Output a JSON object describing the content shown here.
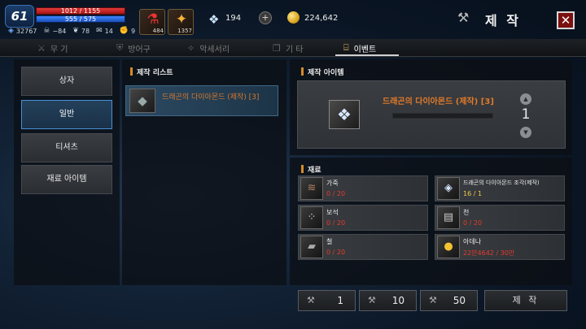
{
  "hud": {
    "level": "61",
    "hp": "1012 / 1155",
    "mp": "555 / 575",
    "stats": [
      {
        "icon": "crystal-small-icon",
        "glyph": "◈",
        "value": "32767"
      },
      {
        "icon": "skull-icon",
        "glyph": "☠",
        "value": "−84"
      },
      {
        "icon": "wing-icon",
        "glyph": "❦",
        "value": "78"
      },
      {
        "icon": "bag-icon",
        "glyph": "✉",
        "value": "14"
      },
      {
        "icon": "fist-icon",
        "glyph": "✊",
        "value": "9"
      }
    ],
    "potion_slot": {
      "icon": "red-potion-icon",
      "glyph": "⚗",
      "count": "484"
    },
    "scroll_slot": {
      "icon": "flame-scroll-icon",
      "glyph": "✦",
      "count": "1357"
    },
    "crystal_currency": "194",
    "gold": "224,642"
  },
  "window": {
    "title": "제 작"
  },
  "tabs": [
    {
      "label": "무 기",
      "icon": "swords-icon",
      "glyph": "⚔"
    },
    {
      "label": "방어구",
      "icon": "shield-icon",
      "glyph": "⛨"
    },
    {
      "label": "악세서리",
      "icon": "ring-icon",
      "glyph": "✧"
    },
    {
      "label": "기 타",
      "icon": "box-icon",
      "glyph": "❒"
    },
    {
      "label": "이벤트",
      "icon": "gift-icon",
      "glyph": "🎁"
    }
  ],
  "active_tab": "이벤트",
  "categories": [
    {
      "label": "상자",
      "active": false
    },
    {
      "label": "일반",
      "active": true
    },
    {
      "label": "티셔츠",
      "active": false
    },
    {
      "label": "재료 아이템",
      "active": false
    }
  ],
  "craft_list": {
    "header": "제작 리스트",
    "items": [
      {
        "name": "드래곤의 다이아몬드 (제작) [3]",
        "icon": "diamond-rough-icon",
        "glyph": "◆"
      }
    ]
  },
  "craft_item": {
    "header": "제작 아이템",
    "name": "드래곤의 다이아몬드 (제작) [3]",
    "quantity": "1",
    "icon": "diamond-icon",
    "glyph": "💎"
  },
  "materials": {
    "header": "재료",
    "items": [
      {
        "name": "가죽",
        "count": "0 / 20",
        "icon": "leather-icon",
        "glyph": "≋",
        "sufficient": false
      },
      {
        "name": "드래곤의 다이아몬드 조각(제작)",
        "count": "16 / 1",
        "icon": "diamond-shard-icon",
        "glyph": "◈",
        "sufficient": true
      },
      {
        "name": "보석",
        "count": "0 / 20",
        "icon": "gems-icon",
        "glyph": "⁘",
        "sufficient": false
      },
      {
        "name": "천",
        "count": "0 / 20",
        "icon": "cloth-icon",
        "glyph": "▤",
        "sufficient": false
      },
      {
        "name": "철",
        "count": "0 / 20",
        "icon": "iron-ingot-icon",
        "glyph": "▰",
        "sufficient": false
      },
      {
        "name": "아데나",
        "count": "22만4642 / 30만",
        "icon": "adena-coins-icon",
        "glyph": "●",
        "sufficient": false
      }
    ]
  },
  "batch_buttons": [
    {
      "value": "1"
    },
    {
      "value": "10"
    },
    {
      "value": "50"
    }
  ],
  "craft_button": "제 작"
}
